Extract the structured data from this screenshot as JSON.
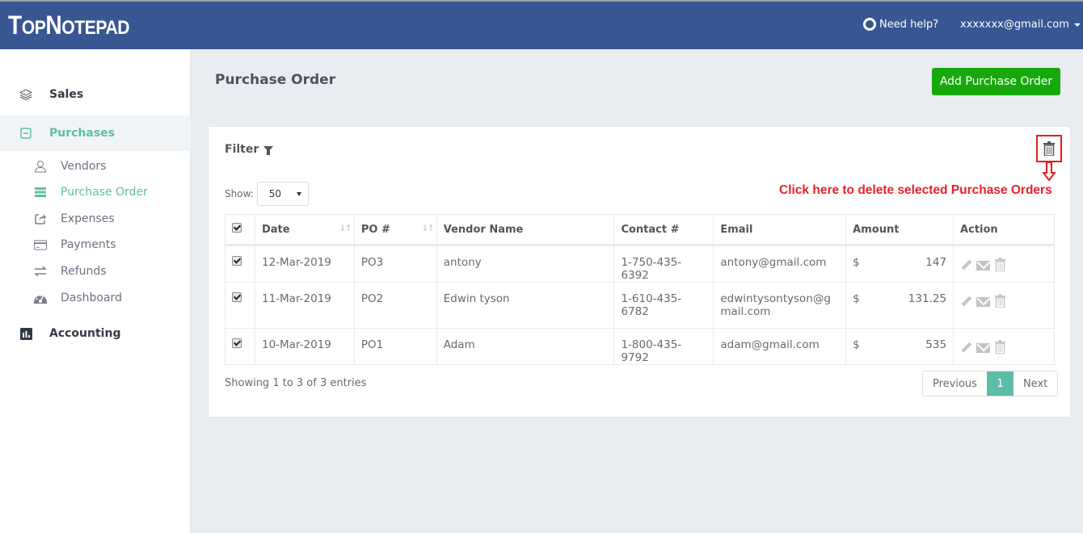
{
  "header": {
    "logo": {
      "t1": "T",
      "t2": "OP",
      "t3": "N",
      "t4": "OTEPAD"
    },
    "help_label": "Need help?",
    "user_email": "xxxxxxx@gmail.com"
  },
  "sidebar": {
    "sales": "Sales",
    "purchases": "Purchases",
    "sub_items": [
      {
        "label": "Vendors",
        "icon": "user-icon"
      },
      {
        "label": "Purchase Order",
        "icon": "list-icon"
      },
      {
        "label": "Expenses",
        "icon": "share-icon"
      },
      {
        "label": "Payments",
        "icon": "credit-card-icon"
      },
      {
        "label": "Refunds",
        "icon": "exchange-icon"
      },
      {
        "label": "Dashboard",
        "icon": "dashboard-icon"
      }
    ],
    "accounting": "Accounting"
  },
  "page": {
    "title": "Purchase Order",
    "add_button": "Add Purchase Order"
  },
  "card": {
    "filter_label": "Filter",
    "annotation": "Click here to delete selected Purchase Orders",
    "show_label": "Show:",
    "show_value": "50",
    "columns": [
      "Date",
      "PO #",
      "Vendor Name",
      "Contact #",
      "Email",
      "Amount",
      "Action"
    ],
    "rows": [
      {
        "date": "12-Mar-2019",
        "po": "PO3",
        "vendor": "antony",
        "contact": "1-750-435-6392",
        "email": "antony@gmail.com",
        "currency": "$",
        "amount": "147",
        "checked": true
      },
      {
        "date": "11-Mar-2019",
        "po": "PO2",
        "vendor": "Edwin tyson",
        "contact": "1-610-435-6782",
        "email": "edwintysontyson@gmail.com",
        "currency": "$",
        "amount": "131.25",
        "checked": true
      },
      {
        "date": "10-Mar-2019",
        "po": "PO1",
        "vendor": "Adam",
        "contact": "1-800-435-9792",
        "email": "adam@gmail.com",
        "currency": "$",
        "amount": "535",
        "checked": true
      }
    ],
    "info": "Showing 1 to 3 of 3 entries",
    "pager": {
      "previous": "Previous",
      "current": "1",
      "next": "Next"
    }
  }
}
